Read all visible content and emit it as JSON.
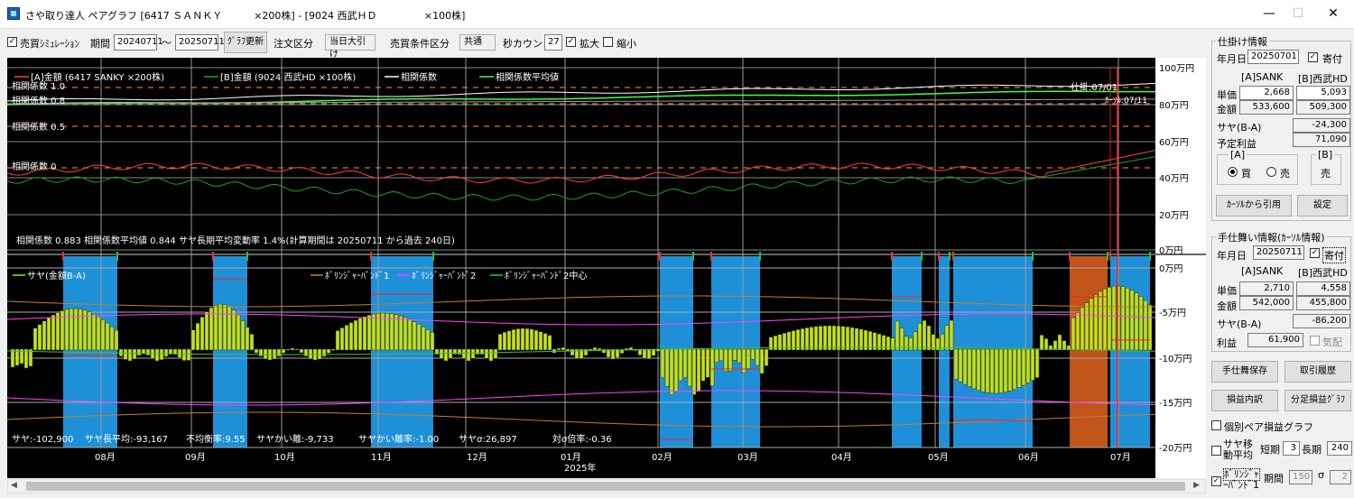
{
  "window": {
    "title": "さや取り達人 ペアグラフ [6417 ＳＡＮＫＹ          ×200株] - [9024 西武ＨＤ               ×100株]",
    "minimize": "—",
    "maximize": "☐",
    "close": "✕"
  },
  "toolbar": {
    "sim_label": "売買ｼﾐｭﾚｰｼｮﾝ",
    "sim_checked": true,
    "period_label": "期間",
    "period_from": "20240711",
    "tilde": "〜",
    "period_to": "20250711",
    "graph_update": "ｸﾞﾗﾌ更新",
    "order_type_label": "注文区分",
    "order_type": "当日大引け",
    "cond_label": "売買条件区分",
    "cond_value": "共通",
    "sec_count_label": "秒カウント",
    "sec_count": "27",
    "zoom_in_label": "拡大",
    "zoom_in_checked": true,
    "zoom_out_label": "縮小",
    "zoom_out_checked": false
  },
  "upper_chart": {
    "legend": [
      {
        "label": "[A]金額 (6417 SANKY    ×200株)",
        "color": "#ff4040"
      },
      {
        "label": "[B]金額 (9024 西武HD     ×100株)",
        "color": "#20a020"
      },
      {
        "label": "相関係数",
        "color": "#ffffff"
      },
      {
        "label": "相関係数平均値",
        "color": "#40ff40"
      }
    ],
    "ref_labels": [
      "相関係数 1.0",
      "相関係数 0.8",
      "相関係数 0.5",
      "相関係数 0"
    ],
    "right_axis": [
      "100万円",
      "80万円",
      "60万円",
      "40万円",
      "20万円",
      "0万円"
    ],
    "annot1": "仕掛:07/01",
    "annot2": "ｶｰｿﾙ:07/11",
    "status": "相関係数 0.883 相関係数平均値 0.844 サヤ長期平均変動率 1.4%(計算期間は 20250711 から過去 240日)"
  },
  "lower_chart": {
    "legend": [
      {
        "label": "サヤ(金額B-A)",
        "color": "#80ff00"
      },
      {
        "label": "ﾎﾞﾘﾝｼﾞｬｰﾊﾞﾝﾄﾞ1",
        "color": "#c08030"
      },
      {
        "label": "ﾎﾞﾘﾝｼﾞｬｰﾊﾞﾝﾄﾞ2",
        "color": "#ff40ff"
      },
      {
        "label": "ﾎﾞﾘﾝｼﾞｬｰﾊﾞﾝﾄﾞ2中心",
        "color": "#40c040"
      }
    ],
    "right_axis": [
      "0万円",
      "-5万円",
      "-10万円",
      "-15万円",
      "-20万円"
    ],
    "stats": [
      {
        "text": "サヤ:-102,900"
      },
      {
        "text": "サヤ長平均:-93,167"
      },
      {
        "text": "不均衡率:9.55"
      },
      {
        "text": "サヤかい離:-9,733"
      },
      {
        "text": "サヤかい離率:-1.00"
      },
      {
        "text": "サヤσ:26,897"
      },
      {
        "text": "対σ倍率:-0.36"
      }
    ]
  },
  "x_axis": {
    "months": [
      "08月",
      "09月",
      "10月",
      "11月",
      "12月",
      "01月",
      "02月",
      "03月",
      "04月",
      "05月",
      "06月",
      "07月"
    ],
    "year_label": "2025年"
  },
  "entry_panel": {
    "title": "仕掛け情報",
    "date_label": "年月日",
    "date": "20250701",
    "yori_label": "寄付",
    "yori_checked": true,
    "col_a": "[A]SANK",
    "col_b": "[B]西武HD",
    "price_label": "単価",
    "price_a": "2,668",
    "price_b": "5,093",
    "amount_label": "金額",
    "amount_a": "533,600",
    "amount_b": "509,300",
    "saya_label": "サヤ(B-A)",
    "saya": "-24,300",
    "plan_label": "予定利益",
    "plan": "71,090",
    "a_label": "[A]",
    "b_label": "[B]",
    "buy_label": "買",
    "sell_label": "売",
    "b_button": "売",
    "cursor_btn": "ｶｰｿﾙから引用",
    "set_btn": "設定"
  },
  "exit_panel": {
    "title": "手仕舞い情報(ｶｰｿﾙ情報)",
    "date_label": "年月日",
    "date": "20250711",
    "yori_label": "寄付",
    "yori_checked": true,
    "col_a": "[A]SANK",
    "col_b": "[B]西武HD",
    "price_label": "単価",
    "price_a": "2,710",
    "price_b": "4,558",
    "amount_label": "金額",
    "amount_a": "542,000",
    "amount_b": "455,800",
    "saya_label": "サヤ(B-A)",
    "saya": "-86,200",
    "profit_label": "利益",
    "profit": "61,900",
    "kisei_label": "気配"
  },
  "buttons": {
    "save": "手仕舞保存",
    "history": "取引履歴",
    "pl_detail": "損益内訳",
    "dist_graph": "分足損益ｸﾞﾗﾌ"
  },
  "options": {
    "pair_pl_label": "個別ペア損益グラフ",
    "pair_pl_checked": false,
    "ma_label1": "サヤ移",
    "ma_label2": "動平均",
    "ma_checked": false,
    "short_label": "短期",
    "short_value": "3",
    "long_label": "長期",
    "long_value": "240",
    "boll_label1": "ﾎﾞﾘﾝｼﾞｬ",
    "boll_label2": "ｰﾊﾞﾝﾄﾞ1",
    "boll_checked": true,
    "period_label": "期間",
    "period_value": "150",
    "sigma_label": "σ",
    "sigma_value": "2"
  },
  "scrollbar": {
    "left": "◀",
    "right": "▶"
  }
}
